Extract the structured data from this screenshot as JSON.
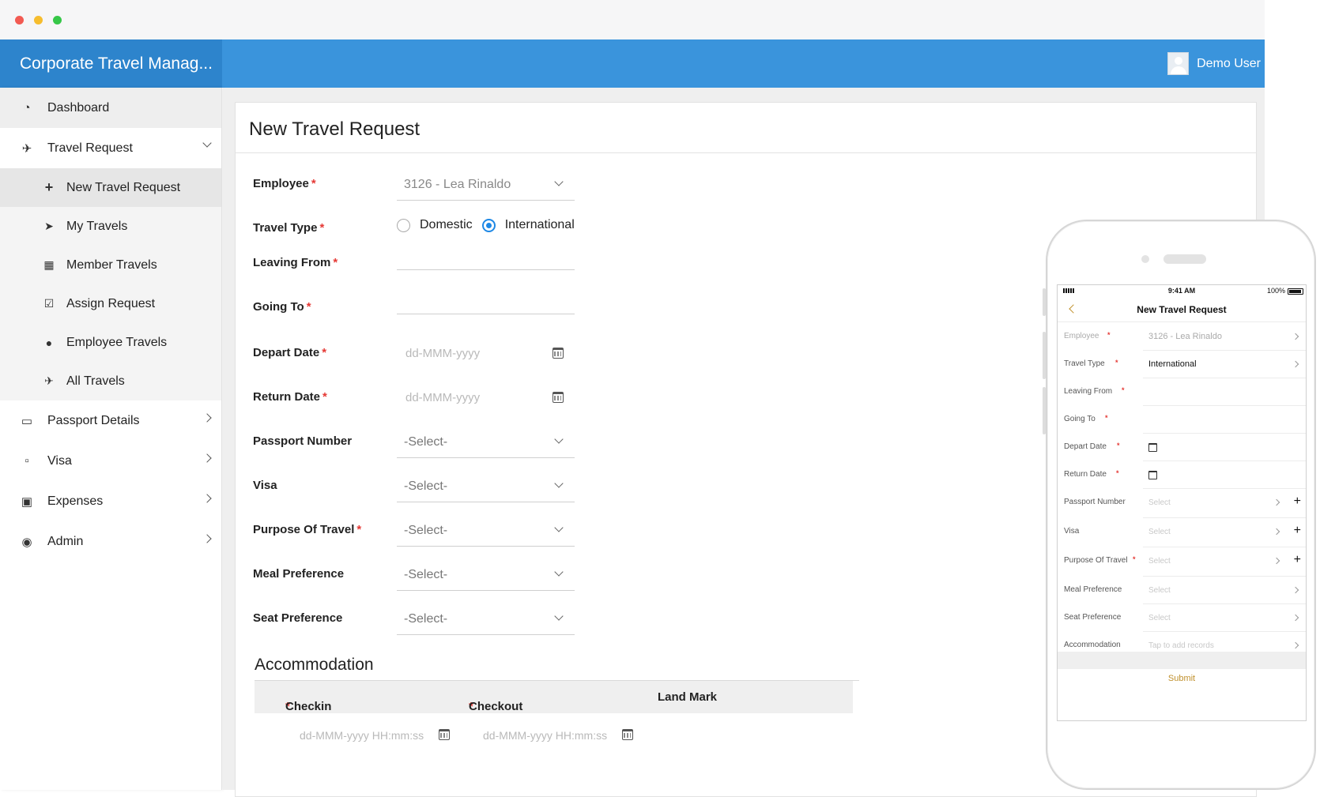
{
  "app": {
    "title": "Corporate Travel Manag...",
    "user": "Demo User",
    "colors": {
      "header": "#3a94dc",
      "brand": "#2d84cc",
      "accent": "#1e88e5",
      "required": "#e53935",
      "mobile_accent": "#c0902c"
    }
  },
  "sidebar": {
    "items": [
      {
        "label": "Dashboard",
        "icon": "dashboard-icon"
      },
      {
        "label": "Travel Request",
        "icon": "plane-icon",
        "expanded": true,
        "children": [
          {
            "label": "New Travel Request",
            "icon": "plus-icon",
            "active": true
          },
          {
            "label": "My Travels",
            "icon": "paper-plane-icon"
          },
          {
            "label": "Member Travels",
            "icon": "table-icon"
          },
          {
            "label": "Assign Request",
            "icon": "checkbox-icon"
          },
          {
            "label": "Employee Travels",
            "icon": "users-icon"
          },
          {
            "label": "All Travels",
            "icon": "plane-icon"
          }
        ]
      },
      {
        "label": "Passport Details",
        "icon": "book-icon"
      },
      {
        "label": "Visa",
        "icon": "map-icon"
      },
      {
        "label": "Expenses",
        "icon": "money-icon"
      },
      {
        "label": "Admin",
        "icon": "lock-icon"
      }
    ]
  },
  "form": {
    "title": "New Travel Request",
    "required_mark": "*",
    "fields": {
      "employee": {
        "label": "Employee",
        "value": "3126 - Lea Rinaldo"
      },
      "travel_type": {
        "label": "Travel Type",
        "options": [
          "Domestic",
          "International"
        ],
        "selected": "International"
      },
      "leaving_from": {
        "label": "Leaving From",
        "value": ""
      },
      "going_to": {
        "label": "Going To",
        "value": ""
      },
      "depart_date": {
        "label": "Depart Date",
        "placeholder": "dd-MMM-yyyy"
      },
      "return_date": {
        "label": "Return Date",
        "placeholder": "dd-MMM-yyyy"
      },
      "passport_number": {
        "label": "Passport Number",
        "value": "-Select-"
      },
      "visa": {
        "label": "Visa",
        "value": "-Select-"
      },
      "purpose": {
        "label": "Purpose Of Travel",
        "value": "-Select-"
      },
      "meal": {
        "label": "Meal Preference",
        "value": "-Select-"
      },
      "seat": {
        "label": "Seat Preference",
        "value": "-Select-"
      }
    },
    "accommodation": {
      "title": "Accommodation",
      "columns": [
        "Checkin",
        "Checkout",
        "Land Mark"
      ],
      "placeholder": "dd-MMM-yyyy HH:mm:ss"
    }
  },
  "mobile": {
    "status": {
      "time": "9:41 AM",
      "battery": "100%"
    },
    "title": "New  Travel Request",
    "rows": [
      {
        "label": "Employee",
        "value": "3126 - Lea  Rinaldo"
      },
      {
        "label": "Travel Type",
        "value": "International"
      },
      {
        "label": "Leaving From",
        "value": ""
      },
      {
        "label": "Going To",
        "value": ""
      },
      {
        "label": "Depart Date",
        "value": ""
      },
      {
        "label": "Return Date",
        "value": ""
      },
      {
        "label": "Passport Number",
        "value": "Select"
      },
      {
        "label": "Visa",
        "value": "Select"
      },
      {
        "label": "Purpose Of Travel",
        "value": "Select"
      },
      {
        "label": "Meal Preference",
        "value": "Select"
      },
      {
        "label": "Seat Preference",
        "value": "Select"
      },
      {
        "label": "Accommodation",
        "value": "Tap to add records"
      }
    ],
    "submit": "Submit"
  }
}
